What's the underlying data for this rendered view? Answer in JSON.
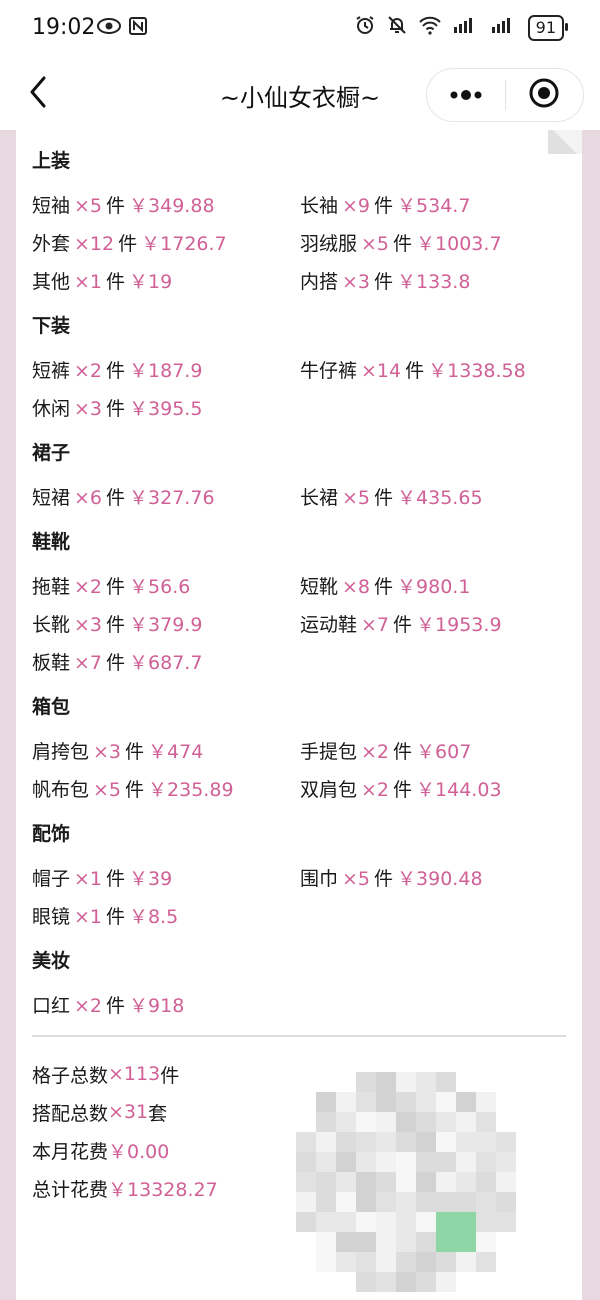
{
  "status_bar": {
    "time": "19:02",
    "left_icons": [
      "eye-icon",
      "nfc-icon"
    ],
    "right_icons": [
      "alarm-icon",
      "mute-icon",
      "wifi-icon",
      "signal-4g-icon",
      "signal-4g-icon"
    ],
    "battery": "91"
  },
  "nav": {
    "title": "~小仙女衣橱~"
  },
  "sections": [
    {
      "title": "上装",
      "items": [
        {
          "name": "短袖",
          "count": "×5",
          "unit": "件",
          "price": "￥349.88"
        },
        {
          "name": "长袖",
          "count": "×9",
          "unit": "件",
          "price": "￥534.7"
        },
        {
          "name": "外套",
          "count": "×12",
          "unit": "件",
          "price": "￥1726.7"
        },
        {
          "name": "羽绒服",
          "count": "×5",
          "unit": "件",
          "price": "￥1003.7"
        },
        {
          "name": "其他",
          "count": "×1",
          "unit": "件",
          "price": "￥19"
        },
        {
          "name": "内搭",
          "count": "×3",
          "unit": "件",
          "price": "￥133.8"
        }
      ]
    },
    {
      "title": "下装",
      "items": [
        {
          "name": "短裤",
          "count": "×2",
          "unit": "件",
          "price": "￥187.9"
        },
        {
          "name": "牛仔裤",
          "count": "×14",
          "unit": "件",
          "price": "￥1338.58"
        },
        {
          "name": "休闲",
          "count": "×3",
          "unit": "件",
          "price": "￥395.5"
        }
      ]
    },
    {
      "title": "裙子",
      "items": [
        {
          "name": "短裙",
          "count": "×6",
          "unit": "件",
          "price": "￥327.76"
        },
        {
          "name": "长裙",
          "count": "×5",
          "unit": "件",
          "price": "￥435.65"
        }
      ]
    },
    {
      "title": "鞋靴",
      "items": [
        {
          "name": "拖鞋",
          "count": "×2",
          "unit": "件",
          "price": "￥56.6"
        },
        {
          "name": "短靴",
          "count": "×8",
          "unit": "件",
          "price": "￥980.1"
        },
        {
          "name": "长靴",
          "count": "×3",
          "unit": "件",
          "price": "￥379.9"
        },
        {
          "name": "运动鞋",
          "count": "×7",
          "unit": "件",
          "price": "￥1953.9"
        },
        {
          "name": "板鞋",
          "count": "×7",
          "unit": "件",
          "price": "￥687.7"
        }
      ]
    },
    {
      "title": "箱包",
      "items": [
        {
          "name": "肩挎包",
          "count": "×3",
          "unit": "件",
          "price": "￥474"
        },
        {
          "name": "手提包",
          "count": "×2",
          "unit": "件",
          "price": "￥607"
        },
        {
          "name": "帆布包",
          "count": "×5",
          "unit": "件",
          "price": "￥235.89"
        },
        {
          "name": "双肩包",
          "count": "×2",
          "unit": "件",
          "price": "￥144.03"
        }
      ]
    },
    {
      "title": "配饰",
      "items": [
        {
          "name": "帽子",
          "count": "×1",
          "unit": "件",
          "price": "￥39"
        },
        {
          "name": "围巾",
          "count": "×5",
          "unit": "件",
          "price": "￥390.48"
        },
        {
          "name": "眼镜",
          "count": "×1",
          "unit": "件",
          "price": "￥8.5"
        }
      ]
    },
    {
      "title": "美妆",
      "items": [
        {
          "name": "口红",
          "count": "×2",
          "unit": "件",
          "price": "￥918"
        }
      ]
    }
  ],
  "summary": [
    {
      "label": "格子总数",
      "value": "×113",
      "suffix": "件"
    },
    {
      "label": "搭配总数",
      "value": "×31",
      "suffix": "套"
    },
    {
      "label": "本月花费",
      "value": "￥0.00",
      "suffix": ""
    },
    {
      "label": "总计花费",
      "value": "￥13328.27",
      "suffix": ""
    }
  ],
  "colors": {
    "accent": "#d06096",
    "side_band": "#e7d9df",
    "qr_highlight": "#8fd6a6"
  }
}
